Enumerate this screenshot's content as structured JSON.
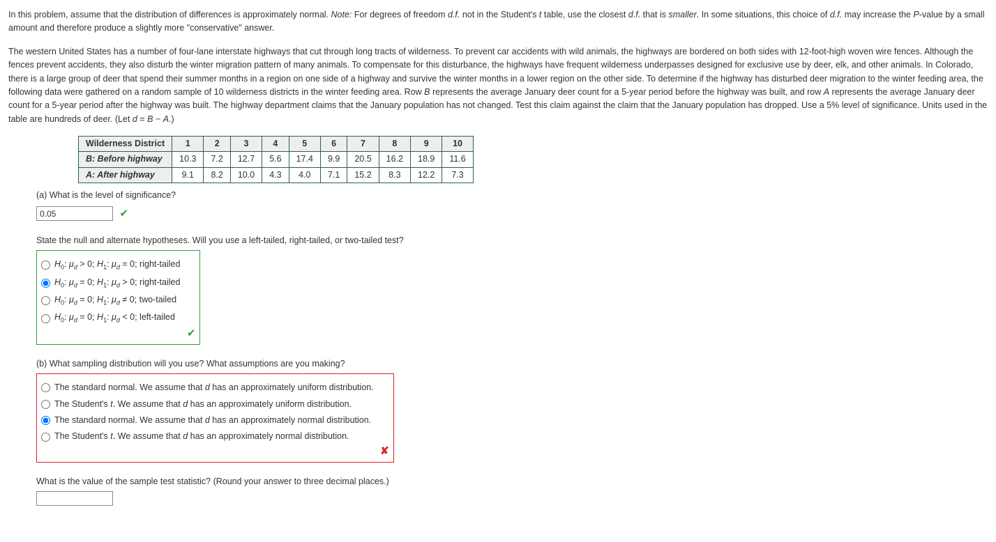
{
  "intro": {
    "p1a": "In this problem, assume that the distribution of differences is approximately normal. ",
    "p1b_note": "Note:",
    "p1c": " For degrees of freedom ",
    "p1d_df": "d.f.",
    "p1e": " not in the Student's ",
    "p1f_t": "t",
    "p1g": " table, use the closest ",
    "p1h_df2": "d.f.",
    "p1i": " that is ",
    "p1j_sm": "smaller",
    "p1k": ". In some situations, this choice of ",
    "p1l_df3": "d.f.",
    "p1m": " may increase the ",
    "p1n_p": "P",
    "p1o": "-value by a small amount and therefore produce a slightly more \"conservative\" answer.",
    "p2a": "The western United States has a number of four-lane interstate highways that cut through long tracts of wilderness. To prevent car accidents with wild animals, the highways are bordered on both sides with 12-foot-high woven wire fences. Although the fences prevent accidents, they also disturb the winter migration pattern of many animals. To compensate for this disturbance, the highways have frequent wilderness underpasses designed for exclusive use by deer, elk, and other animals. In Colorado, there is a large group of deer that spend their summer months in a region on one side of a highway and survive the winter months in a lower region on the other side. To determine if the highway has disturbed deer migration to the winter feeding area, the following data were gathered on a random sample of 10 wilderness districts in the winter feeding area. Row ",
    "p2b_B": "B",
    "p2c": " represents the average January deer count for a 5-year period before the highway was built, and row ",
    "p2d_A": "A",
    "p2e": " represents the average January deer count for a 5-year period after the highway was built. The highway department claims that the January population has not changed. Test this claim against the claim that the January population has dropped. Use a 5% level of significance. Units used in the table are hundreds of deer. (Let ",
    "p2f_d": "d",
    "p2g": " = ",
    "p2h_B2": "B",
    "p2i": " − ",
    "p2j_A2": "A",
    "p2k": ".)"
  },
  "table": {
    "h0": "Wilderness District",
    "cols": [
      "1",
      "2",
      "3",
      "4",
      "5",
      "6",
      "7",
      "8",
      "9",
      "10"
    ],
    "r1h": "B: Before highway",
    "r1": [
      "10.3",
      "7.2",
      "12.7",
      "5.6",
      "17.4",
      "9.9",
      "20.5",
      "16.2",
      "18.9",
      "11.6"
    ],
    "r2h": "A: After highway",
    "r2": [
      "9.1",
      "8.2",
      "10.0",
      "4.3",
      "4.0",
      "7.1",
      "15.2",
      "8.3",
      "12.2",
      "7.3"
    ]
  },
  "qa": {
    "a_text": "(a) What is the level of significance?",
    "a_value": "0.05",
    "hypo_q": "State the null and alternate hypotheses. Will you use a left-tailed, right-tailed, or two-tailed test?",
    "hypo": {
      "o1_tail": " > 0; ",
      "o1_tail2": " = 0; right-tailed",
      "o2_tail": " = 0; ",
      "o2_tail2": " > 0; right-tailed",
      "o3_tail": " = 0; ",
      "o3_tail2": " ≠ 0; two-tailed",
      "o4_tail": " = 0; ",
      "o4_tail2": " < 0; left-tailed",
      "H0": "H",
      "H1": "H",
      "mu": "μ",
      "sub0": "0",
      "sub1": "1",
      "subd": "d",
      "colon": ": "
    },
    "b_text": "(b) What sampling distribution will you use? What assumptions are you making?",
    "b_opts": {
      "o1a": "The standard normal. We assume that ",
      "o1b": " has an approximately uniform distribution.",
      "o2a": "The Student's ",
      "o2b": ". We assume that ",
      "o2c": " has an approximately uniform distribution.",
      "o3a": "The standard normal. We assume that ",
      "o3b": " has an approximately normal distribution.",
      "o4a": "The Student's ",
      "o4b": ". We assume that ",
      "o4c": " has an approximately normal distribution.",
      "d": "d",
      "t": "t"
    },
    "stat_q": "What is the value of the sample test statistic? (Round your answer to three decimal places.)"
  }
}
